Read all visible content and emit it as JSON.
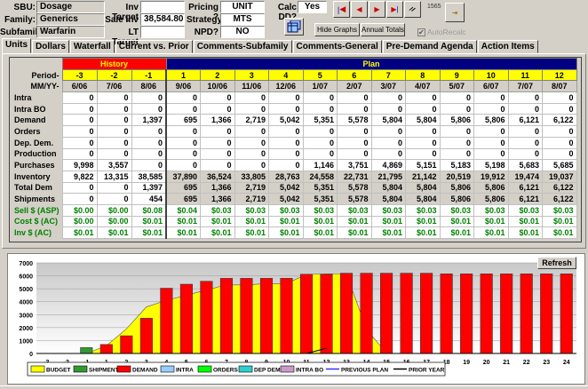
{
  "header": {
    "sbu_label": "SBU:",
    "sbu": "Dosage",
    "family_label": "Family:",
    "family": "Generics",
    "subfamily_label": "Subfamily:",
    "subfamily": "Warfarin",
    "inv_target_label": "Inv Target",
    "inv_target": "",
    "sale_inv_label": "Sale Inv",
    "sale_inv": "38,584.80",
    "lt_target_label": "LT Target",
    "lt_target": "",
    "pricing_label": "Pricing ?",
    "pricing": "UNIT",
    "strategy_label": "Strategy?",
    "strategy": "MTS",
    "npd_label": "NPD?",
    "npd": "NO",
    "calc_dd_label": "Calc DD?",
    "calc_dd": "Yes",
    "record_id": "1565",
    "hide_graphs": "Hide Graphs",
    "annual_totals": "Annual Totals",
    "autorecalc": "AutoRecalc",
    "autorecalc_checked": true
  },
  "tabs": [
    "Units",
    "Dollars",
    "Waterfall",
    "Current vs. Prior",
    "Comments-Subfamily",
    "Comments-General",
    "Pre-Demand Agenda",
    "Action Items"
  ],
  "grid": {
    "history_label": "History",
    "plan_label": "Plan",
    "period_label": "Period-",
    "mmyy_label": "MM/YY-",
    "periods": [
      "-3",
      "-2",
      "-1",
      "1",
      "2",
      "3",
      "4",
      "5",
      "6",
      "7",
      "8",
      "9",
      "10",
      "11",
      "12"
    ],
    "dates": [
      "6/06",
      "7/06",
      "8/06",
      "9/06",
      "10/06",
      "11/06",
      "12/06",
      "1/07",
      "2/07",
      "3/07",
      "4/07",
      "5/07",
      "6/07",
      "7/07",
      "8/07"
    ],
    "rows": [
      {
        "label": "Intra",
        "values": [
          "0",
          "0",
          "0",
          "0",
          "0",
          "0",
          "0",
          "0",
          "0",
          "0",
          "0",
          "0",
          "0",
          "0",
          "0"
        ]
      },
      {
        "label": "Intra BO",
        "values": [
          "0",
          "0",
          "0",
          "0",
          "0",
          "0",
          "0",
          "0",
          "0",
          "0",
          "0",
          "0",
          "0",
          "0",
          "0"
        ]
      },
      {
        "label": "Demand",
        "values": [
          "0",
          "0",
          "1,397",
          "695",
          "1,366",
          "2,719",
          "5,042",
          "5,351",
          "5,578",
          "5,804",
          "5,804",
          "5,806",
          "5,806",
          "6,121",
          "6,122"
        ]
      },
      {
        "label": "Orders",
        "values": [
          "0",
          "0",
          "0",
          "0",
          "0",
          "0",
          "0",
          "0",
          "0",
          "0",
          "0",
          "0",
          "0",
          "0",
          "0"
        ]
      },
      {
        "label": "Dep. Dem.",
        "values": [
          "0",
          "0",
          "0",
          "0",
          "0",
          "0",
          "0",
          "0",
          "0",
          "0",
          "0",
          "0",
          "0",
          "0",
          "0"
        ]
      },
      {
        "label": "Production",
        "values": [
          "0",
          "0",
          "0",
          "0",
          "0",
          "0",
          "0",
          "0",
          "0",
          "0",
          "0",
          "0",
          "0",
          "0",
          "0"
        ]
      },
      {
        "label": "Purchases",
        "values": [
          "9,998",
          "3,557",
          "0",
          "0",
          "0",
          "0",
          "0",
          "1,146",
          "3,751",
          "4,869",
          "5,151",
          "5,183",
          "5,198",
          "5,683",
          "5,685"
        ]
      },
      {
        "label": "Inventory",
        "values": [
          "9,822",
          "13,315",
          "38,585",
          "37,890",
          "36,524",
          "33,805",
          "28,763",
          "24,558",
          "22,731",
          "21,795",
          "21,142",
          "20,519",
          "19,912",
          "19,474",
          "19,037"
        ]
      },
      {
        "label": "Total Dem",
        "values": [
          "0",
          "0",
          "1,397",
          "695",
          "1,366",
          "2,719",
          "5,042",
          "5,351",
          "5,578",
          "5,804",
          "5,804",
          "5,806",
          "5,806",
          "6,121",
          "6,122"
        ]
      },
      {
        "label": "Shipments",
        "values": [
          "0",
          "0",
          "454",
          "695",
          "1,366",
          "2,719",
          "5,042",
          "5,351",
          "5,578",
          "5,804",
          "5,804",
          "5,806",
          "5,806",
          "6,121",
          "6,122"
        ]
      },
      {
        "label": "Sell $ (ASP)",
        "values": [
          "$0.00",
          "$0.00",
          "$0.08",
          "$0.04",
          "$0.03",
          "$0.03",
          "$0.03",
          "$0.03",
          "$0.03",
          "$0.03",
          "$0.03",
          "$0.03",
          "$0.03",
          "$0.03",
          "$0.03"
        ]
      },
      {
        "label": "Cost $ (AC)",
        "values": [
          "$0.00",
          "$0.00",
          "$0.01",
          "$0.01",
          "$0.01",
          "$0.01",
          "$0.01",
          "$0.01",
          "$0.01",
          "$0.01",
          "$0.01",
          "$0.01",
          "$0.01",
          "$0.01",
          "$0.01"
        ]
      },
      {
        "label": "Inv $ (AC)",
        "values": [
          "$0.01",
          "$0.01",
          "$0.01",
          "$0.01",
          "$0.01",
          "$0.01",
          "$0.01",
          "$0.01",
          "$0.01",
          "$0.01",
          "$0.01",
          "$0.01",
          "$0.01",
          "$0.01",
          "$0.01"
        ]
      }
    ]
  },
  "chart": {
    "refresh": "Refresh"
  },
  "chart_data": {
    "type": "bar",
    "categories": [
      "-3",
      "-2",
      "-1",
      "1",
      "2",
      "3",
      "4",
      "5",
      "6",
      "7",
      "8",
      "9",
      "10",
      "11",
      "12",
      "13",
      "14",
      "15",
      "16",
      "17",
      "18",
      "19",
      "20",
      "21",
      "22",
      "23",
      "24"
    ],
    "ylim": [
      0,
      7000
    ],
    "yticks": [
      "0",
      "1000",
      "2000",
      "3000",
      "4000",
      "5000",
      "6000",
      "7000"
    ],
    "grid": true,
    "legend_position": "bottom",
    "series": [
      {
        "name": "BUDGET",
        "type": "area",
        "color": "#ffff00",
        "values": [
          0,
          0,
          0,
          600,
          1900,
          3600,
          4100,
          4500,
          4900,
          5300,
          5300,
          5400,
          5400,
          6100,
          6150,
          6150,
          1900,
          0,
          0,
          0,
          0,
          0,
          0,
          0,
          0,
          0,
          0
        ]
      },
      {
        "name": "SHIPMENTS",
        "type": "bar",
        "color": "#339933",
        "values": [
          0,
          0,
          454,
          0,
          0,
          0,
          0,
          0,
          0,
          0,
          0,
          0,
          0,
          0,
          0,
          0,
          0,
          0,
          0,
          0,
          0,
          0,
          0,
          0,
          0,
          0,
          0
        ]
      },
      {
        "name": "DEMAND",
        "type": "bar",
        "color": "#ff0000",
        "values": [
          0,
          0,
          0,
          695,
          1366,
          2719,
          5042,
          5351,
          5578,
          5804,
          5804,
          5806,
          5806,
          6121,
          6122,
          6200,
          6200,
          6200,
          6200,
          6200,
          6150,
          6150,
          6150,
          6150,
          6150,
          6150,
          6150
        ]
      },
      {
        "name": "INTRA",
        "type": "bar",
        "color": "#99ccff",
        "values": []
      },
      {
        "name": "ORDERS",
        "type": "bar",
        "color": "#00ff00",
        "values": []
      },
      {
        "name": "DEP DEM",
        "type": "bar",
        "color": "#33cccc",
        "values": []
      },
      {
        "name": "INTRA BO",
        "type": "bar",
        "color": "#cc99cc",
        "values": []
      },
      {
        "name": "PREVIOUS PLAN",
        "type": "line",
        "color": "#3333ff",
        "values": [
          0,
          0,
          0,
          0,
          0,
          0,
          0,
          0,
          0,
          0,
          0,
          0,
          0,
          0,
          0,
          0,
          0,
          0,
          0,
          0,
          0,
          0,
          0,
          0,
          0,
          0,
          0
        ]
      },
      {
        "name": "PRIOR YEAR",
        "type": "line",
        "color": "#000000",
        "values": [
          0,
          0,
          0,
          0,
          0,
          0,
          0,
          0,
          0,
          0,
          0,
          0,
          0,
          0,
          400
        ]
      }
    ]
  }
}
